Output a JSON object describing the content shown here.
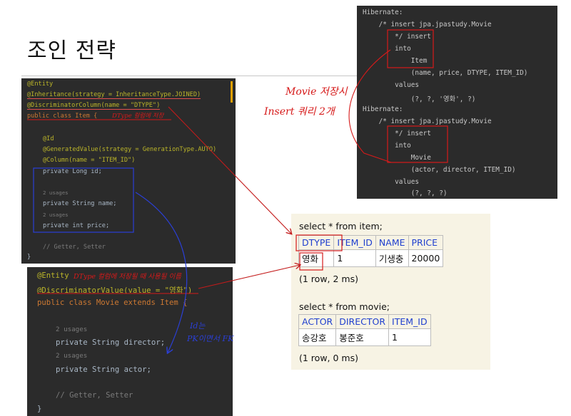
{
  "slide": {
    "title": "조인 전략"
  },
  "code_item": {
    "lines": [
      "@Entity",
      "@Inheritance(strategy = InheritanceType.JOINED)",
      "@DiscriminatorColumn(name = \"DTYPE\")",
      "public class Item {",
      "@Id",
      "@GeneratedValue(strategy = GenerationType.AUTO)",
      "@Column(name = \"ITEM_ID\")",
      "private Long id;",
      "2 usages",
      "private String name;",
      "2 usages",
      "private int price;",
      "// Getter, Setter",
      "}"
    ]
  },
  "code_movie": {
    "lines": [
      "@Entity",
      "@DiscriminatorValue(value = \"영화\")",
      "public class Movie extends Item {",
      "2 usages",
      "private String director;",
      "2 usages",
      "private String actor;",
      "// Getter, Setter",
      "}"
    ]
  },
  "hibernate_log": {
    "lines": [
      "Hibernate:",
      "    /* insert jpa.jpastudy.Movie",
      "        */ insert",
      "        into",
      "            Item",
      "            (name, price, DTYPE, ITEM_ID)",
      "        values",
      "            (?, ?, '영화', ?)",
      "Hibernate:",
      "    /* insert jpa.jpastudy.Movie",
      "        */ insert",
      "        into",
      "            Movie",
      "            (actor, director, ITEM_ID)",
      "        values",
      "            (?, ?, ?)"
    ]
  },
  "query_results": {
    "q1": "select * from item;",
    "item_headers": [
      "DTYPE",
      "ITEM_ID",
      "NAME",
      "PRICE"
    ],
    "item_row": [
      "영화",
      "1",
      "기생충",
      "20000"
    ],
    "q1_info": "(1 row, 2 ms)",
    "q2": "select * from movie;",
    "movie_headers": [
      "ACTOR",
      "DIRECTOR",
      "ITEM_ID"
    ],
    "movie_row": [
      "송강호",
      "봉준호",
      "1"
    ],
    "q2_info": "(1 row, 0 ms)"
  },
  "annotations": {
    "dtype_column": "DType 컬럼에 저장",
    "discriminator_value": "DType 컬럼에 저장될 때 사용될 이름",
    "movie_save_1": "Movie 저장시",
    "movie_save_2": "Insert 쿼리 2개",
    "pk_fk_1": "Id는",
    "pk_fk_2": "PK이면서 FK"
  },
  "colors": {
    "code_bg": "#2b2b2b",
    "annotation_red": "#d61a1a",
    "annotation_blue": "#2b3fd6",
    "result_bg": "#f7f3e4",
    "header_blue": "#1f3fcf"
  }
}
